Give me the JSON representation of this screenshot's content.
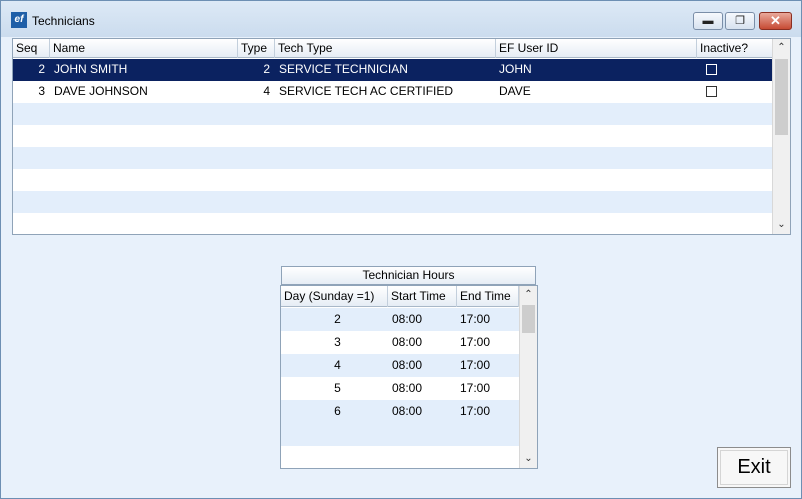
{
  "window": {
    "title": "Technicians",
    "app_icon_text": "ef"
  },
  "grid": {
    "columns": [
      "Seq",
      "Name",
      "Type",
      "Tech Type",
      "EF User ID",
      "Inactive?"
    ],
    "rows": [
      {
        "seq": "2",
        "name": "JOHN SMITH",
        "type": "2",
        "tech_type": "SERVICE TECHNICIAN",
        "user_id": "JOHN",
        "inactive": false,
        "selected": true
      },
      {
        "seq": "3",
        "name": "DAVE JOHNSON",
        "type": "4",
        "tech_type": "SERVICE TECH AC CERTIFIED",
        "user_id": "DAVE",
        "inactive": false,
        "selected": false
      }
    ]
  },
  "hours": {
    "title": "Technician Hours",
    "columns": [
      "Day (Sunday =1)",
      "Start Time",
      "End Time"
    ],
    "rows": [
      {
        "day": "2",
        "start": "08:00",
        "end": "17:00"
      },
      {
        "day": "3",
        "start": "08:00",
        "end": "17:00"
      },
      {
        "day": "4",
        "start": "08:00",
        "end": "17:00"
      },
      {
        "day": "5",
        "start": "08:00",
        "end": "17:00"
      },
      {
        "day": "6",
        "start": "08:00",
        "end": "17:00"
      }
    ]
  },
  "buttons": {
    "exit_label": "Exit"
  },
  "colors": {
    "selected_row": "#0b2260",
    "alt_row": "#e3eefb",
    "window_bg": "#e8f1fb"
  },
  "icons": {
    "minimize": "minimize-icon",
    "restore": "restore-icon",
    "close": "close-icon",
    "scroll_up": "chevron-up-icon",
    "scroll_down": "chevron-down-icon"
  }
}
